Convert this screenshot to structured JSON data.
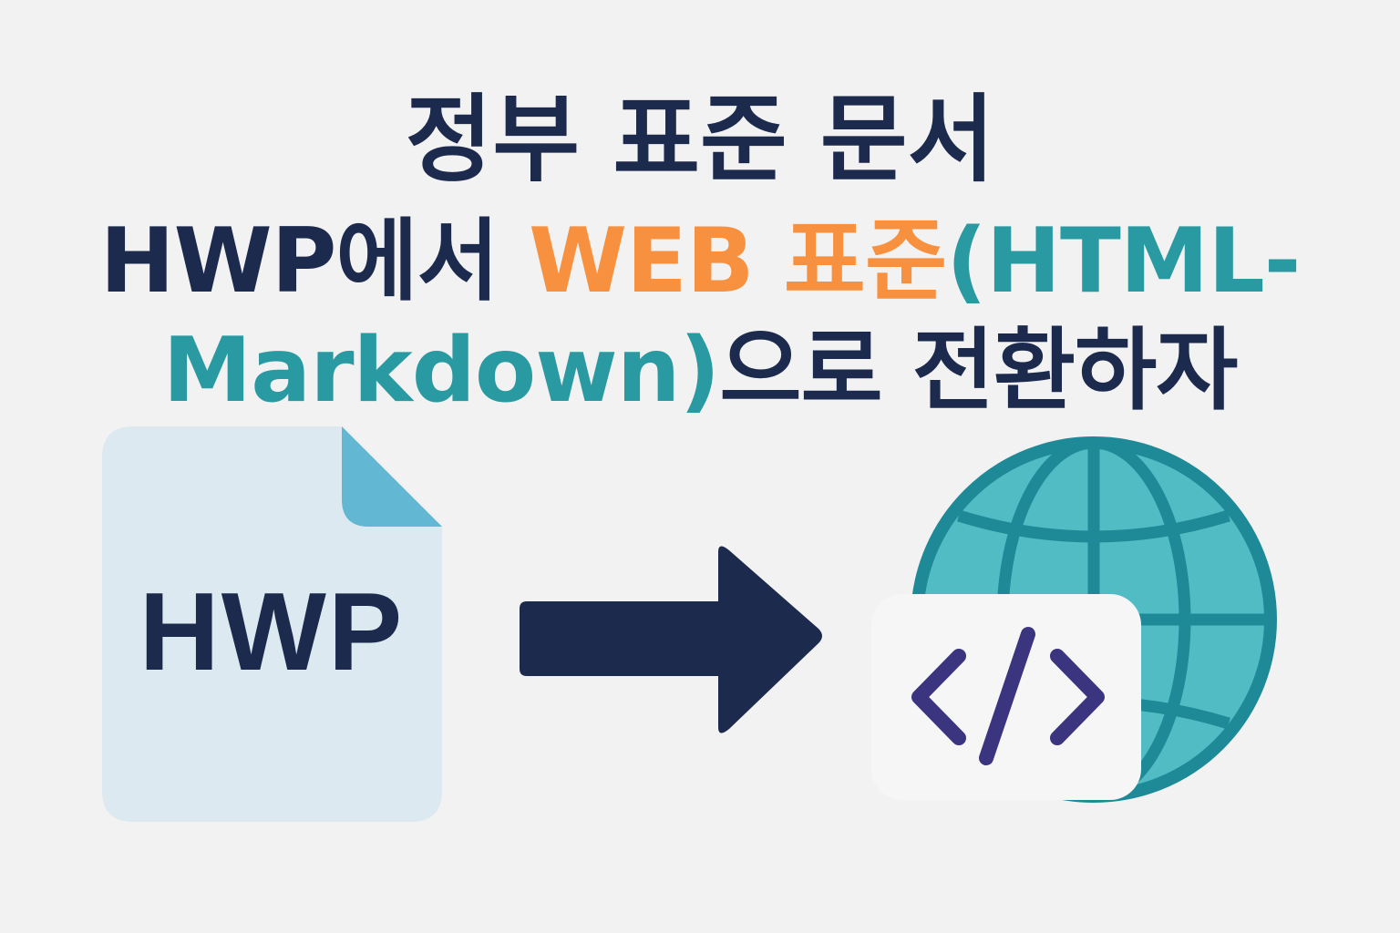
{
  "title": {
    "line1": "정부 표준 문서",
    "line2": {
      "part1": "HWP에서 ",
      "part2": "WEB 표준",
      "part3": "(HTML-"
    },
    "line3": {
      "part1": "Markdown)",
      "part2": "으로 전환하자"
    }
  },
  "document": {
    "label": "HWP"
  },
  "colors": {
    "background": "#f2f2f2",
    "navy": "#1c2a4d",
    "orange": "#f7913f",
    "teal": "#2a9aa2",
    "doc_fill": "#dce9f1",
    "doc_fold": "#62b7d3",
    "globe_fill": "#52bcc4",
    "globe_stroke": "#1f8a97",
    "code_color": "#3b3580"
  },
  "icons": [
    "document-icon",
    "arrow-right-icon",
    "globe-icon",
    "code-icon"
  ]
}
